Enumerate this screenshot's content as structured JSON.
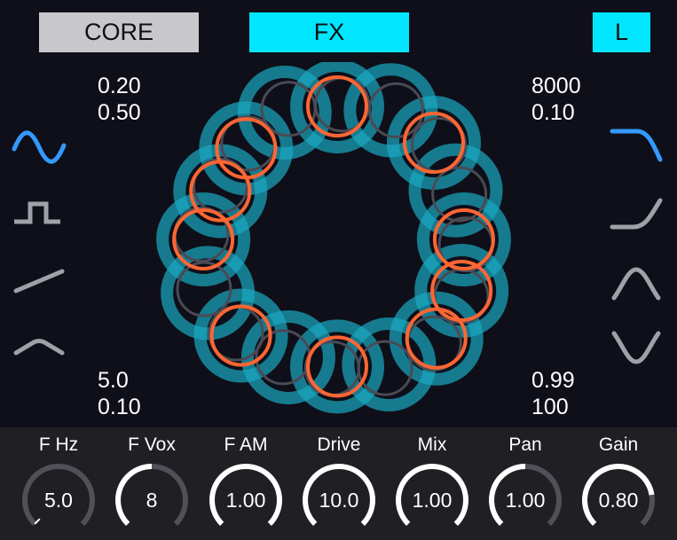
{
  "tabs": {
    "core": "CORE",
    "fx": "FX",
    "channel": "L"
  },
  "params": {
    "top_left": [
      "0.20",
      "0.50"
    ],
    "top_right": [
      "8000",
      "0.10"
    ],
    "bottom_left": [
      "5.0",
      "0.10"
    ],
    "bottom_right": [
      "0.99",
      "100"
    ]
  },
  "waveforms": {
    "left": [
      {
        "name": "sine-wave-icon",
        "active": true
      },
      {
        "name": "square-wave-icon",
        "active": false
      },
      {
        "name": "saw-wave-icon",
        "active": false
      },
      {
        "name": "triangle-wave-icon",
        "active": false
      }
    ],
    "right": [
      {
        "name": "lowpass-filter-icon",
        "active": true
      },
      {
        "name": "highpass-filter-icon",
        "active": false
      },
      {
        "name": "bandpass-filter-icon",
        "active": false
      },
      {
        "name": "notch-filter-icon",
        "active": false
      }
    ]
  },
  "knobs": [
    {
      "label": "F Hz",
      "value": "5.0",
      "level": 0.0
    },
    {
      "label": "F Vox",
      "value": "8",
      "level": 0.5
    },
    {
      "label": "F AM",
      "value": "1.00",
      "level": 1.0
    },
    {
      "label": "Drive",
      "value": "10.0",
      "level": 1.0
    },
    {
      "label": "Mix",
      "value": "1.00",
      "level": 1.0
    },
    {
      "label": "Pan",
      "value": "1.00",
      "level": 0.5
    },
    {
      "label": "Gain",
      "value": "0.80",
      "level": 0.8
    }
  ],
  "colors": {
    "accent": "#00e6ff",
    "active_icon": "#3399ff",
    "inactive_icon": "#a0a0a8",
    "orange": "#ff6633",
    "teal": "#1aa9c2",
    "background": "#0f0f19",
    "panel": "#202024"
  }
}
